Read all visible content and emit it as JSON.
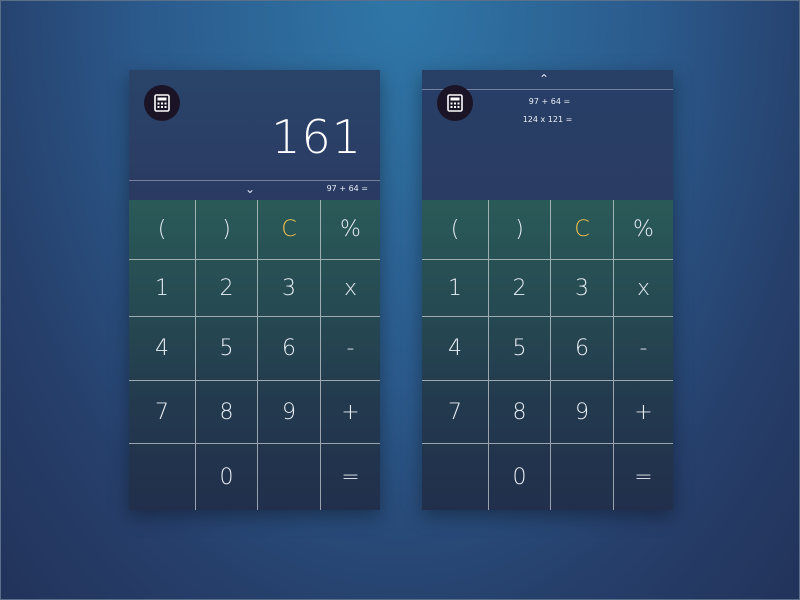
{
  "left_phone": {
    "result": "161",
    "history_inline": "97 + 64 =",
    "chevron": "⌄"
  },
  "right_phone": {
    "chevron": "⌃",
    "history": [
      "97 + 64 =",
      "124 x 121 ="
    ]
  },
  "keypad": {
    "rows": [
      [
        "(",
        ")",
        "C",
        "%"
      ],
      [
        "1",
        "2",
        "3",
        "x"
      ],
      [
        "4",
        "5",
        "6",
        "-"
      ],
      [
        "7",
        "8",
        "9",
        "+"
      ],
      [
        "",
        "0",
        "",
        "="
      ]
    ]
  },
  "colors": {
    "accent_teal": "#22a79c",
    "clear_key": "#f2c14a",
    "badge": "#1b1326"
  },
  "icons": {
    "calculator": "calculator-icon"
  }
}
